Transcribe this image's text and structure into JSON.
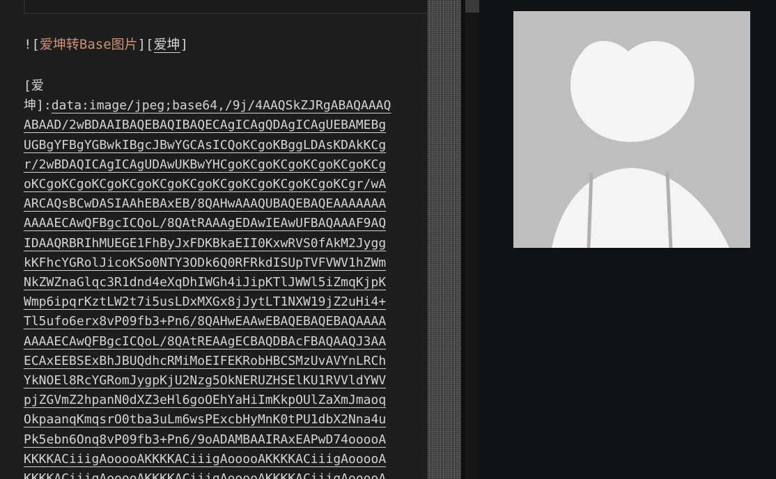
{
  "editor": {
    "image_line": {
      "prefix": "![",
      "alt": "爱坤转Base图片",
      "middle": "][",
      "ref": "爱坤",
      "suffix": "]"
    },
    "definition": {
      "open": "[爱",
      "label_rest": "坤]:",
      "first_url": "data:image/jpeg;base64,/9j/4AAQSkZJRgABAQAAAQ",
      "lines": [
        "ABAAD/2wBDAAIBAQEBAQIBAQECAgICAgQDAgICAgUEBAMEBg",
        "UGBgYFBgYGBwkIBgcJBwYGCAsICQoKCgoKBggLDAsKDAkKCg",
        "r/2wBDAQICAgICAgUDAwUKBwYHCgoKCgoKCgoKCgoKCgoKCg",
        "oKCgoKCgoKCgoKCgoKCgoKCgoKCgoKCgoKCgoKCgoKCgr/wA",
        "ARCAQsBCwDASIAAhEBAxEB/8QAHwAAAQUBAQEBAQEAAAAAAA",
        "AAAAECAwQFBgcICQoL/8QAtRAAAgEDAwIEAwUFBAQAAAF9AQ",
        "IDAAQRBRIhMUEGE1FhByJxFDKBkaEII0KxwRVS0fAkM2Jygg",
        "kKFhcYGRolJicoKSo0NTY3ODk6Q0RFRkdISUpTVFVWV1hZWm",
        "NkZWZnaGlqc3R1dnd4eXqDhIWGh4iJipKTlJWWl5iZmqKjpK",
        "Wmp6ipqrKztLW2t7i5usLDxMXGx8jJytLT1NXW19jZ2uHi4+",
        "Tl5ufo6erx8vP09fb3+Pn6/8QAHwEAAwEBAQEBAQEBAQAAAA",
        "AAAAECAwQFBgcICQoL/8QAtREAAgECBAQDBAcFBAQAAQJ3AA",
        "ECAxEEBSExBhJBUQdhcRMiMoEIFEKRobHBCSMzUvAVYnLRCh",
        "YkNOEl8RcYGRomJygpKjU2Nzg5OkNERUZHSElKU1RVVldYWV",
        "pjZGVmZ2hpanN0dXZ3eHl6goOEhYaHiImKkpOUlZaXmJmaoq",
        "OkpaanqKmqsrO0tba3uLm6wsPExcbHyMnK0tPU1dbX2Nna4u",
        "Pk5ebn6Onq8vP09fb3+Pn6/9oADAMBAAIRAxEAPwD74ooooA",
        "KKKKACiiigAooooAKKKKACiiigAooooAKKKKACiiigAooooA",
        "KKKKACiiigAooooAKKKKACiiigAooooAKKKKACiiigAooooA"
      ]
    }
  },
  "colors": {
    "editor_bg": "#1e1e1e",
    "text": "#d4d4d4",
    "alt_text": "#ce9178",
    "preview_bg": "#0f1217",
    "avatar_bg": "#bebebe",
    "avatar_figure": "#f4f4f4"
  }
}
